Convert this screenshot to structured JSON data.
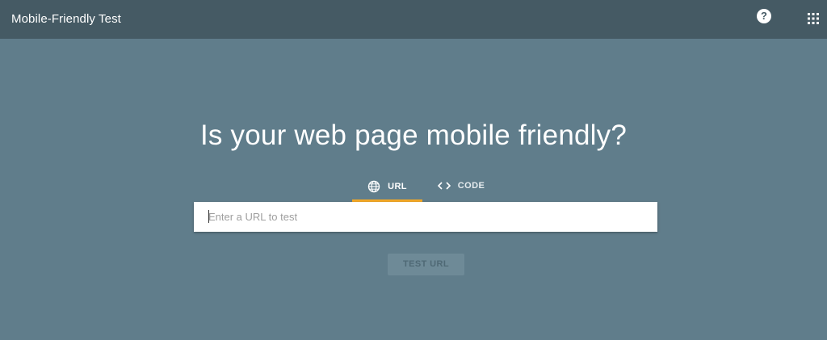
{
  "header": {
    "title": "Mobile-Friendly Test",
    "help_icon": "help-circle-icon",
    "help_glyph": "?",
    "apps_icon": "apps-grid-icon"
  },
  "main": {
    "heading": "Is your web page mobile friendly?",
    "tabs": [
      {
        "label": "URL",
        "icon": "globe-icon",
        "selected": true
      },
      {
        "label": "CODE",
        "icon": "code-icon",
        "selected": false
      }
    ],
    "url_input": {
      "value": "",
      "placeholder": "Enter a URL to test"
    },
    "test_button": {
      "label": "TEST URL",
      "disabled": true
    }
  },
  "colors": {
    "background": "#607d8b",
    "topbar": "#455a64",
    "tab_indicator": "#f4a825",
    "text": "#ffffff"
  }
}
